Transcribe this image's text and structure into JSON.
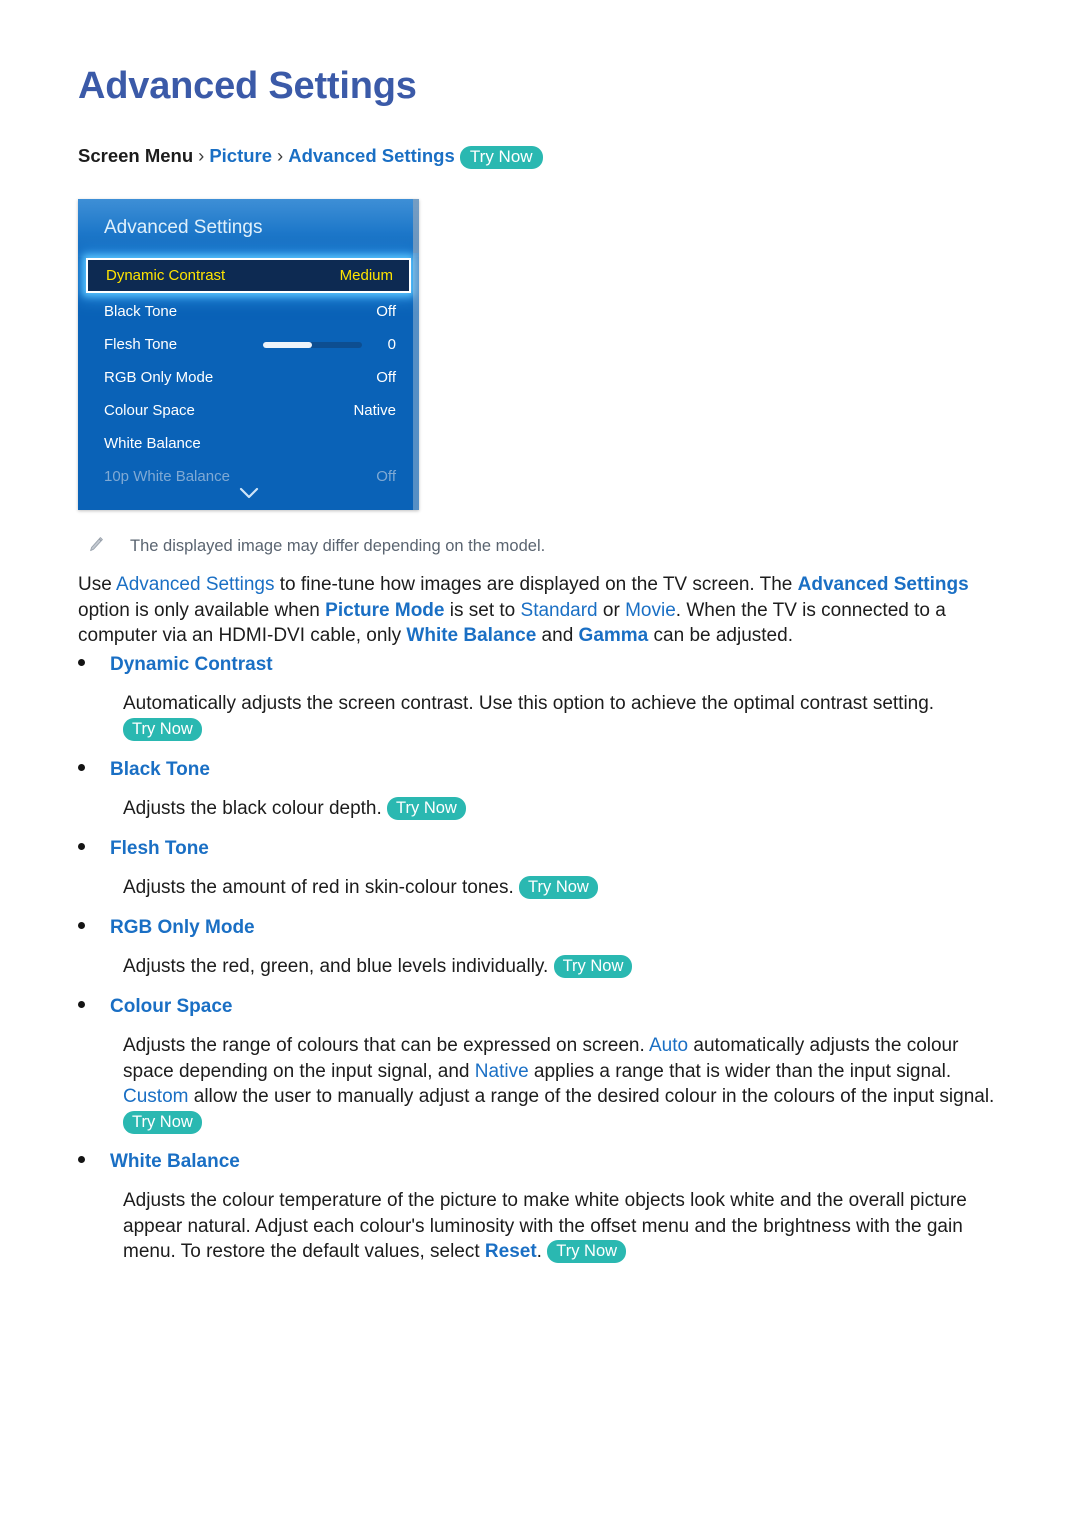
{
  "document": {
    "title": "Advanced Settings"
  },
  "breadcrumb": {
    "root": "Screen Menu",
    "sep": "›",
    "level1": "Picture",
    "level2": "Advanced Settings",
    "try_now": "Try Now"
  },
  "tv_menu": {
    "header": "Advanced Settings",
    "scroll_chevron_icon": "chevron-down-icon",
    "rows": [
      {
        "label": "Dynamic Contrast",
        "value": "Medium",
        "state": "selected"
      },
      {
        "label": "Black Tone",
        "value": "Off",
        "state": "normal"
      },
      {
        "label": "Flesh Tone",
        "value": "0",
        "state": "slider",
        "slider_percent": 50
      },
      {
        "label": "RGB Only Mode",
        "value": "Off",
        "state": "normal"
      },
      {
        "label": "Colour Space",
        "value": "Native",
        "state": "normal"
      },
      {
        "label": "White Balance",
        "value": "",
        "state": "normal"
      },
      {
        "label": "10p White Balance",
        "value": "Off",
        "state": "dimmed"
      }
    ]
  },
  "note": {
    "icon": "pencil-icon",
    "text": "The displayed image may differ depending on the model."
  },
  "intro": {
    "p1": "Use ",
    "l1": "Advanced Settings",
    "p2": " to fine-tune how images are displayed on the TV screen. The ",
    "l2": "Advanced Settings",
    "p3": " option is only available when ",
    "l3": "Picture Mode",
    "p4": " is set to ",
    "l4": "Standard",
    "p5": " or ",
    "l5": "Movie",
    "p6": ". When the TV is connected to a computer via an HDMI-DVI cable, only ",
    "l6": "White Balance",
    "p7": " and ",
    "l7": "Gamma",
    "p8": " can be adjusted."
  },
  "sections": {
    "dynamic_contrast": {
      "heading": "Dynamic Contrast",
      "body": "Automatically adjusts the screen contrast. Use this option to achieve the optimal contrast setting. ",
      "try_now": "Try Now"
    },
    "black_tone": {
      "heading": "Black Tone",
      "body": "Adjusts the black colour depth. ",
      "try_now": "Try Now"
    },
    "flesh_tone": {
      "heading": "Flesh Tone",
      "body": "Adjusts the amount of red in skin-colour tones. ",
      "try_now": "Try Now"
    },
    "rgb_only_mode": {
      "heading": "RGB Only Mode",
      "body": "Adjusts the red, green, and blue levels individually. ",
      "try_now": "Try Now"
    },
    "colour_space": {
      "heading": "Colour Space",
      "b1": "Adjusts the range of colours that can be expressed on screen. ",
      "t1": "Auto",
      "b2": " automatically adjusts the colour space depending on the input signal, and ",
      "t2": "Native",
      "b3": " applies a range that is wider than the input signal. ",
      "t3": "Custom",
      "b4": " allow the user to manually adjust a range of the desired colour in the colours of the input signal. ",
      "try_now": "Try Now"
    },
    "white_balance": {
      "heading": "White Balance",
      "b1": "Adjusts the colour temperature of the picture to make white objects look white and the overall picture appear natural. Adjust each colour's luminosity with the offset menu and the brightness with the gain menu. To restore the default values, select ",
      "t1": "Reset",
      "b2": ". ",
      "try_now": "Try Now"
    }
  },
  "colors": {
    "title_blue": "#3b5aa8",
    "link_blue": "#1a6fc4",
    "badge_teal": "#2ab8b1",
    "panel_blue": "#0a62b7",
    "selected_navy": "#0d2a52",
    "selected_yellow": "#ffe400"
  }
}
